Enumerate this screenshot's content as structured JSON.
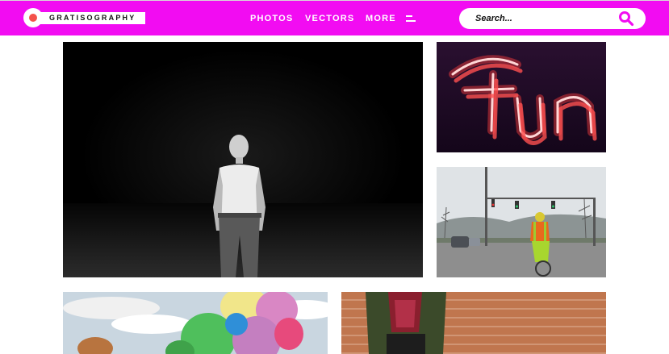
{
  "header": {
    "logo_text": "GRATISOGRAPHY",
    "nav": {
      "photos": "PHOTOS",
      "vectors": "VECTORS",
      "more": "MORE"
    }
  },
  "search": {
    "placeholder": "Search...",
    "value": ""
  },
  "icons": {
    "logo": "logo-dot",
    "menu": "hamburger-icon",
    "search": "magnifier-icon"
  },
  "colors": {
    "header_bg": "#f20cf2",
    "logo_dot": "#f4524b",
    "accent": "#f20cf2"
  },
  "gallery": {
    "items": [
      {
        "subject": "man-in-white-tshirt-dark"
      },
      {
        "subject": "neon-fun-sign"
      },
      {
        "subject": "cyclist-at-intersection"
      },
      {
        "subject": "colorful-balloons-sky"
      },
      {
        "subject": "person-brick-wall"
      }
    ]
  }
}
